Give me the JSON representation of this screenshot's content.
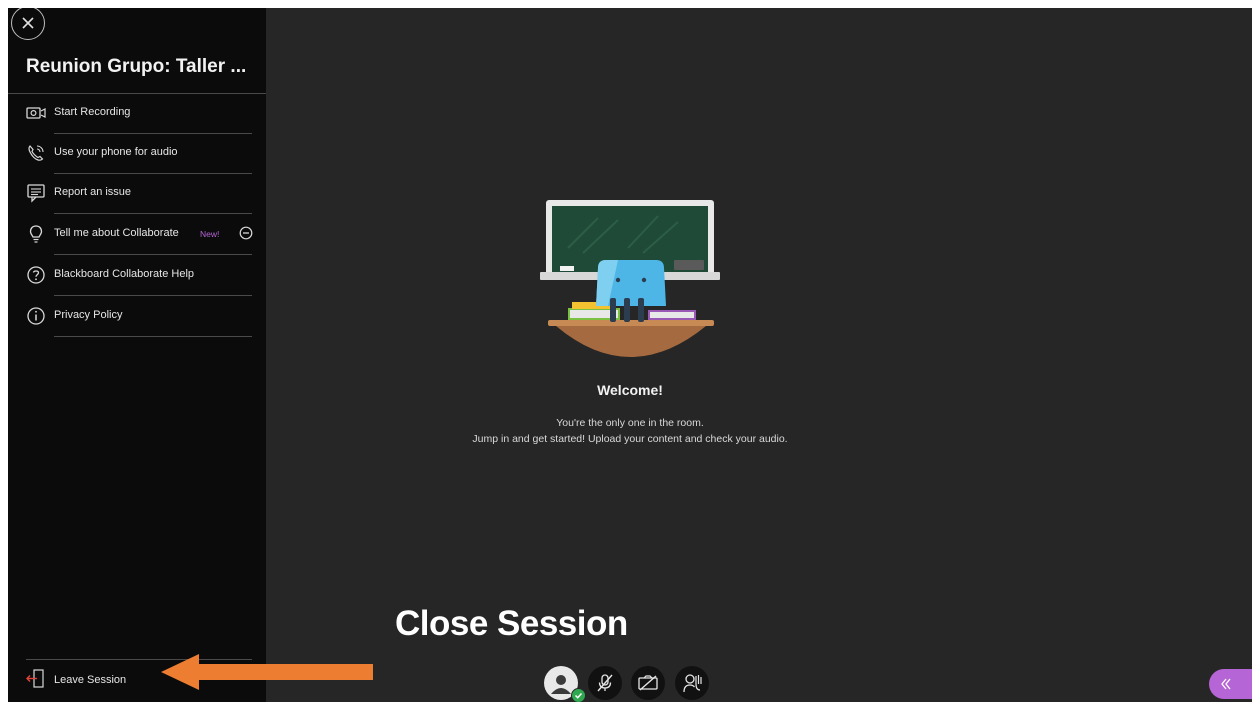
{
  "session": {
    "title": "Reunion Grupo: Taller ..."
  },
  "menu": {
    "items": [
      {
        "label": "Start Recording",
        "icon": "camera-record-icon"
      },
      {
        "label": "Use your phone for audio",
        "icon": "phone-audio-icon"
      },
      {
        "label": "Report an issue",
        "icon": "report-issue-icon"
      },
      {
        "label": "Tell me about Collaborate",
        "icon": "lightbulb-icon",
        "badge": "New!"
      },
      {
        "label": "Blackboard Collaborate Help",
        "icon": "help-icon"
      },
      {
        "label": "Privacy Policy",
        "icon": "info-icon"
      }
    ],
    "leave": {
      "label": "Leave Session",
      "icon": "leave-session-icon"
    }
  },
  "main": {
    "welcome_title": "Welcome!",
    "welcome_line1": "You're the only one in the room.",
    "welcome_line2": "Jump in and get started! Upload your content and check your audio."
  },
  "annotation": {
    "text": "Close Session",
    "arrow_color": "#ed7d31"
  },
  "controls": [
    {
      "name": "my-status-avatar",
      "icon": "avatar-icon"
    },
    {
      "name": "microphone-toggle",
      "icon": "microphone-off-icon"
    },
    {
      "name": "camera-toggle",
      "icon": "camera-off-icon"
    },
    {
      "name": "hand-raise",
      "icon": "raise-hand-icon"
    }
  ],
  "colors": {
    "sidebar_bg": "#0b0b0b",
    "main_bg": "#262626",
    "accent_purple": "#b565d6",
    "status_green": "#2fa84f"
  }
}
